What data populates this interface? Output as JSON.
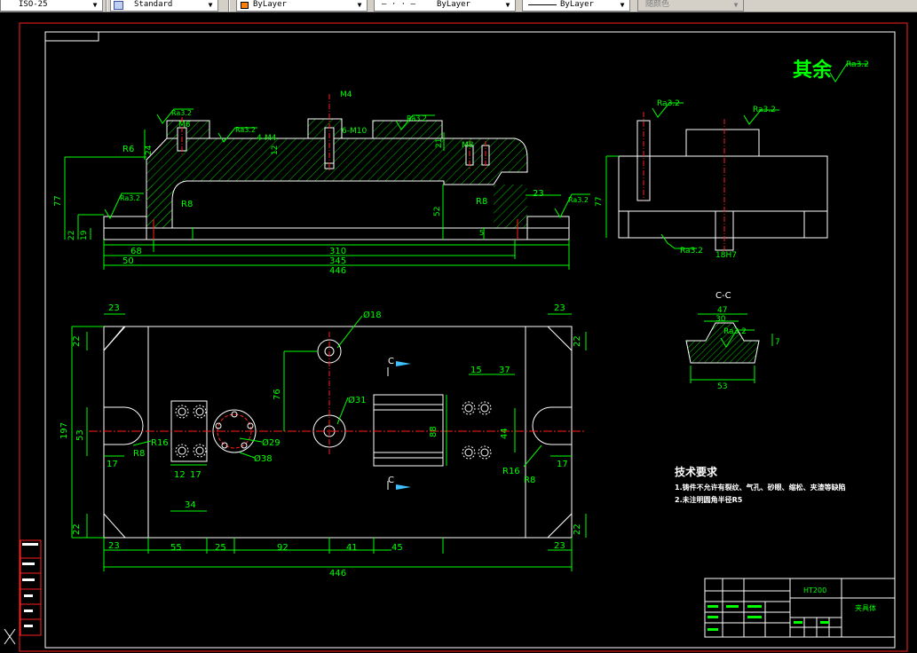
{
  "toolbar": {
    "dimstyle": "ISO-25",
    "textstyle": "Standard",
    "layer_color": "ByLayer",
    "linetype": "ByLayer",
    "linetype_preview": "— · · —",
    "lineweight": "ByLayer",
    "plotstyle": "随颜色",
    "colors": {
      "accent_swatch": "#ff8000"
    }
  },
  "drawing": {
    "roughness_general_label": "其余",
    "roughness": "Ra3.2",
    "tech_req_title": "技术要求",
    "tech_req_1": "1.铸件不允许有裂纹、气孔、砂眼、缩松、夹渣等缺陷",
    "tech_req_2": "2.未注明圆角半径R5",
    "section_label": "C-C",
    "section_mark": "C",
    "material": "HT200",
    "part_name": "夹具体",
    "dims": {
      "R6": "R6",
      "R8": "R8",
      "R8b": "R8",
      "M6": "M6",
      "M4": "M4",
      "4M4": "4-M4",
      "6M10": "6-M10",
      "M8": "M8",
      "d24": "24",
      "d12": "12",
      "d21": "21",
      "d77": "77",
      "d22": "22",
      "d19": "19",
      "d52": "52",
      "d23": "23",
      "d5": "5",
      "d68": "68",
      "d50": "50",
      "d310": "310",
      "d345": "345",
      "d446": "446",
      "d77r": "77",
      "d18H7": "18H7",
      "d47": "47",
      "d30": "30",
      "d7": "7",
      "d53": "53",
      "t23a": "23",
      "t23b": "23",
      "t22a": "22",
      "t22b": "22",
      "phi18": "Ø18",
      "d76": "76",
      "d15": "15",
      "d37": "37",
      "d197": "197",
      "d53b": "53",
      "R16": "R16",
      "R8c": "R8",
      "phi31": "Ø31",
      "d88": "88",
      "d44": "44",
      "d17a": "17",
      "d17b": "17",
      "phi29": "Ø29",
      "phi38": "Ø38",
      "R16b": "R16",
      "R8d": "R8",
      "d12b": "12",
      "d17c": "17",
      "d34": "34",
      "b22a": "22",
      "b22b": "22",
      "b23a": "23",
      "b23b": "23",
      "b55": "55",
      "b25": "25",
      "b92": "92",
      "b41": "41",
      "b45": "45",
      "b446": "446"
    }
  }
}
